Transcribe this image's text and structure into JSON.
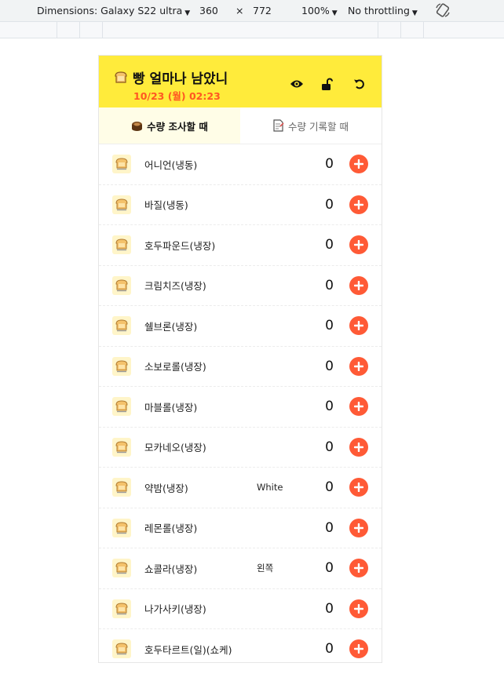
{
  "devtools": {
    "device_label": "Dimensions: Galaxy S22 ultra",
    "width": "360",
    "times": "×",
    "height": "772",
    "zoom": "100%",
    "throttle": "No throttling"
  },
  "app": {
    "title": "빵 얼마나 남았니",
    "date": "10/23 (월) 02:23",
    "accent": "#ffeb3b",
    "date_color": "#ff5722",
    "icons": [
      "eye-icon",
      "unlock-icon",
      "refresh-icon"
    ]
  },
  "tabs": [
    {
      "label": "수량 조사할 때",
      "icon": "cake-icon",
      "active": true
    },
    {
      "label": "수량 기록할 때",
      "icon": "memo-icon",
      "active": false
    }
  ],
  "items": [
    {
      "name": "어니언(냉동)",
      "note": "",
      "count": "0"
    },
    {
      "name": "바질(냉동)",
      "note": "",
      "count": "0"
    },
    {
      "name": "호두파운드(냉장)",
      "note": "",
      "count": "0"
    },
    {
      "name": "크림치즈(냉장)",
      "note": "",
      "count": "0"
    },
    {
      "name": "쉘브론(냉장)",
      "note": "",
      "count": "0"
    },
    {
      "name": "소보로롤(냉장)",
      "note": "",
      "count": "0"
    },
    {
      "name": "마블롤(냉장)",
      "note": "",
      "count": "0"
    },
    {
      "name": "모카네오(냉장)",
      "note": "",
      "count": "0"
    },
    {
      "name": "약밤(냉장)",
      "note": "White",
      "count": "0"
    },
    {
      "name": "레몬롤(냉장)",
      "note": "",
      "count": "0"
    },
    {
      "name": "쇼콜라(냉장)",
      "note": "왼쪽",
      "count": "0"
    },
    {
      "name": "나가사키(냉장)",
      "note": "",
      "count": "0"
    },
    {
      "name": "호두타르트(일)(쇼케)",
      "note": "",
      "count": "0"
    }
  ]
}
